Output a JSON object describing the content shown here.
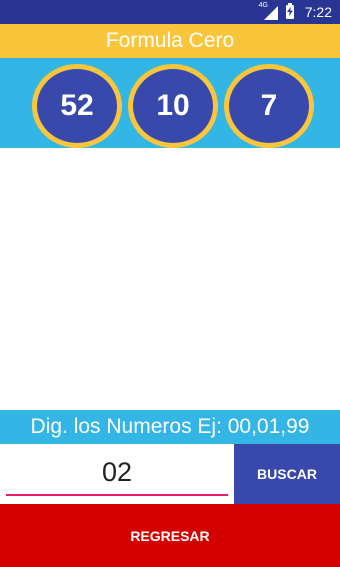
{
  "status_bar": {
    "network": "4G",
    "time": "7:22",
    "icons": [
      "network-icon",
      "signal-icon",
      "battery-icon"
    ]
  },
  "header": {
    "title": "Formula Cero"
  },
  "numbers": [
    "52",
    "10",
    "7"
  ],
  "hint": "Dig. los Numeros Ej: 00,01,99",
  "search": {
    "value": "02",
    "button_label": "BUSCAR"
  },
  "back_button_label": "REGRESAR",
  "colors": {
    "status_bar": "#283593",
    "title_bar": "#f9c53b",
    "ball_bar": "#33b5e5",
    "ball_fill": "#3949ab",
    "ball_border": "#f9c53b",
    "buscar": "#3949ab",
    "regresar": "#d50000",
    "input_underline": "#e91e63"
  }
}
